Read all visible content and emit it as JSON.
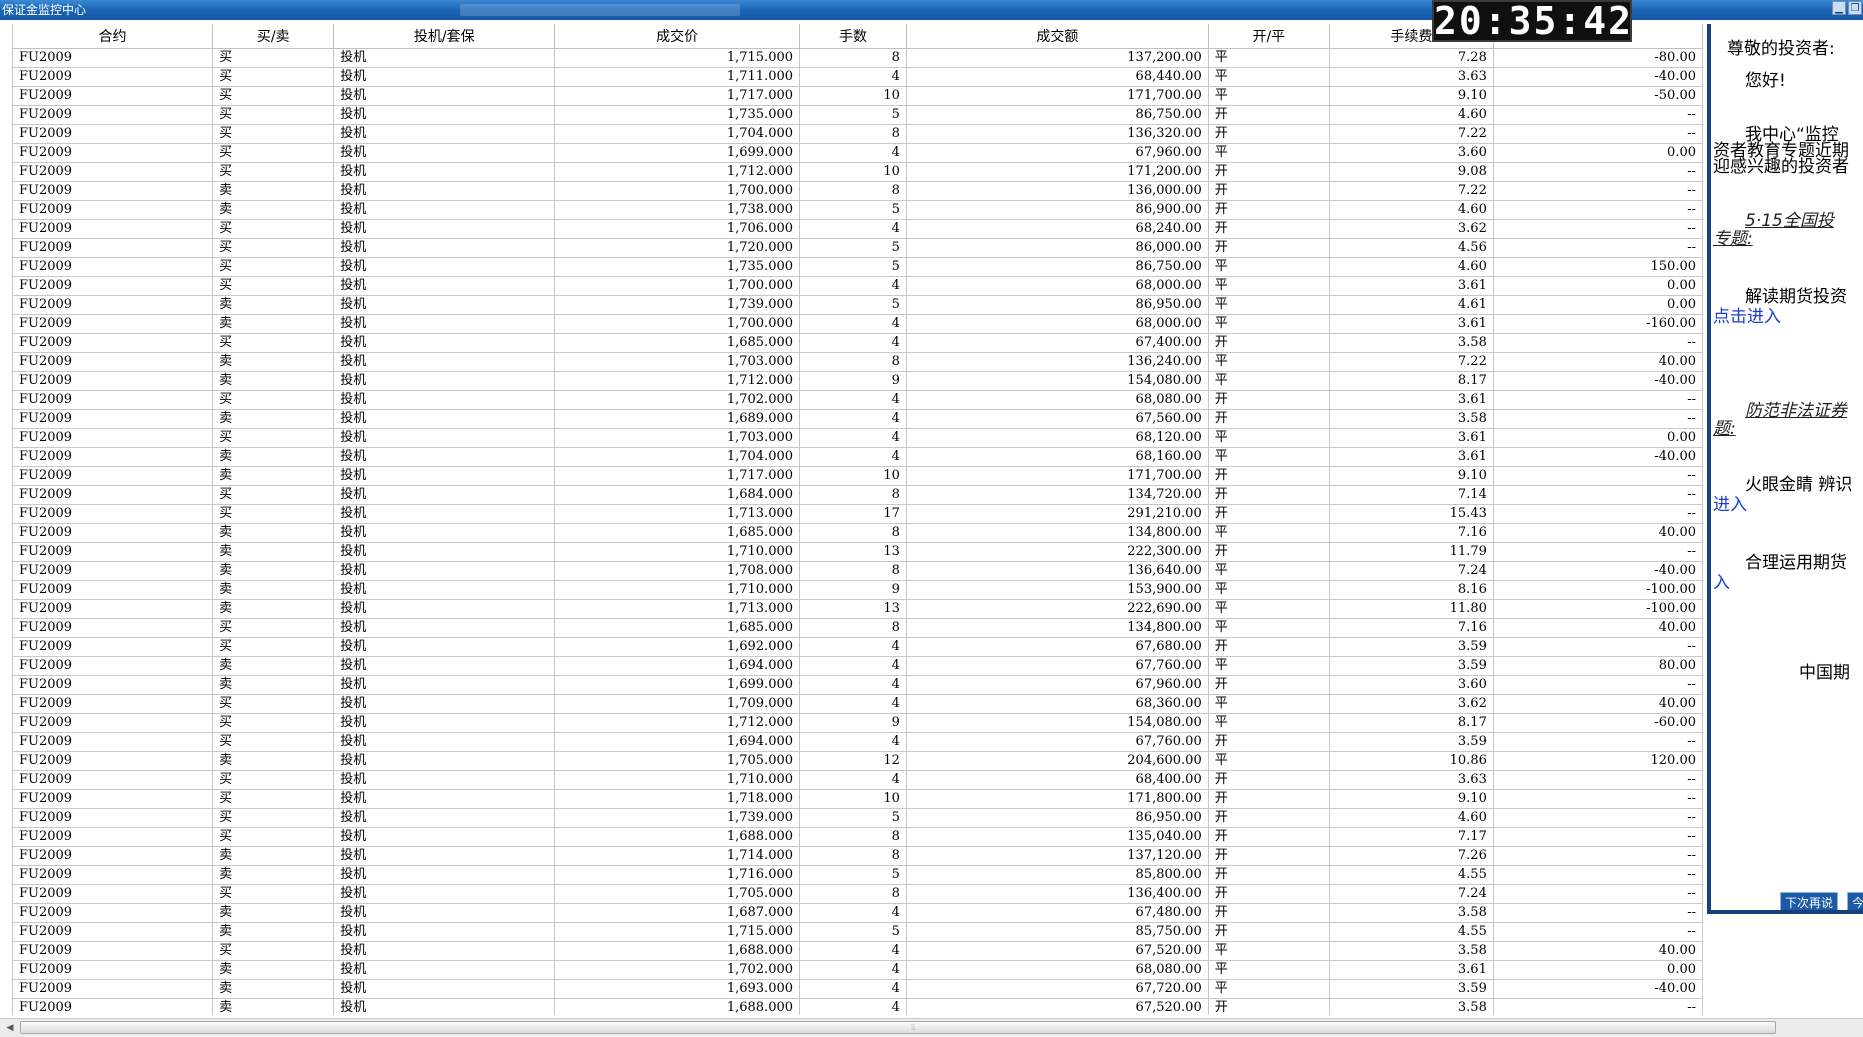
{
  "window": {
    "title": "保证金监控中心",
    "clock": "20:35:42"
  },
  "table": {
    "headers": [
      "合约",
      "买/卖",
      "投机/套保",
      "成交价",
      "手数",
      "成交额",
      "开/平",
      "手续费",
      ""
    ],
    "rows": [
      [
        "FU2009",
        "买",
        "投机",
        "1,715.000",
        "8",
        "137,200.00",
        "平",
        "7.28",
        "-80.00"
      ],
      [
        "FU2009",
        "买",
        "投机",
        "1,711.000",
        "4",
        "68,440.00",
        "平",
        "3.63",
        "-40.00"
      ],
      [
        "FU2009",
        "买",
        "投机",
        "1,717.000",
        "10",
        "171,700.00",
        "平",
        "9.10",
        "-50.00"
      ],
      [
        "FU2009",
        "买",
        "投机",
        "1,735.000",
        "5",
        "86,750.00",
        "开",
        "4.60",
        "--"
      ],
      [
        "FU2009",
        "买",
        "投机",
        "1,704.000",
        "8",
        "136,320.00",
        "开",
        "7.22",
        "--"
      ],
      [
        "FU2009",
        "买",
        "投机",
        "1,699.000",
        "4",
        "67,960.00",
        "平",
        "3.60",
        "0.00"
      ],
      [
        "FU2009",
        "买",
        "投机",
        "1,712.000",
        "10",
        "171,200.00",
        "开",
        "9.08",
        "--"
      ],
      [
        "FU2009",
        "卖",
        "投机",
        "1,700.000",
        "8",
        "136,000.00",
        "开",
        "7.22",
        "--"
      ],
      [
        "FU2009",
        "卖",
        "投机",
        "1,738.000",
        "5",
        "86,900.00",
        "开",
        "4.60",
        "--"
      ],
      [
        "FU2009",
        "买",
        "投机",
        "1,706.000",
        "4",
        "68,240.00",
        "开",
        "3.62",
        "--"
      ],
      [
        "FU2009",
        "买",
        "投机",
        "1,720.000",
        "5",
        "86,000.00",
        "开",
        "4.56",
        "--"
      ],
      [
        "FU2009",
        "买",
        "投机",
        "1,735.000",
        "5",
        "86,750.00",
        "平",
        "4.60",
        "150.00"
      ],
      [
        "FU2009",
        "买",
        "投机",
        "1,700.000",
        "4",
        "68,000.00",
        "平",
        "3.61",
        "0.00"
      ],
      [
        "FU2009",
        "卖",
        "投机",
        "1,739.000",
        "5",
        "86,950.00",
        "平",
        "4.61",
        "0.00"
      ],
      [
        "FU2009",
        "卖",
        "投机",
        "1,700.000",
        "4",
        "68,000.00",
        "平",
        "3.61",
        "-160.00"
      ],
      [
        "FU2009",
        "买",
        "投机",
        "1,685.000",
        "4",
        "67,400.00",
        "开",
        "3.58",
        "--"
      ],
      [
        "FU2009",
        "卖",
        "投机",
        "1,703.000",
        "8",
        "136,240.00",
        "平",
        "7.22",
        "40.00"
      ],
      [
        "FU2009",
        "卖",
        "投机",
        "1,712.000",
        "9",
        "154,080.00",
        "平",
        "8.17",
        "-40.00"
      ],
      [
        "FU2009",
        "买",
        "投机",
        "1,702.000",
        "4",
        "68,080.00",
        "开",
        "3.61",
        "--"
      ],
      [
        "FU2009",
        "卖",
        "投机",
        "1,689.000",
        "4",
        "67,560.00",
        "开",
        "3.58",
        "--"
      ],
      [
        "FU2009",
        "买",
        "投机",
        "1,703.000",
        "4",
        "68,120.00",
        "平",
        "3.61",
        "0.00"
      ],
      [
        "FU2009",
        "卖",
        "投机",
        "1,704.000",
        "4",
        "68,160.00",
        "平",
        "3.61",
        "-40.00"
      ],
      [
        "FU2009",
        "卖",
        "投机",
        "1,717.000",
        "10",
        "171,700.00",
        "开",
        "9.10",
        "--"
      ],
      [
        "FU2009",
        "买",
        "投机",
        "1,684.000",
        "8",
        "134,720.00",
        "开",
        "7.14",
        "--"
      ],
      [
        "FU2009",
        "买",
        "投机",
        "1,713.000",
        "17",
        "291,210.00",
        "开",
        "15.43",
        "--"
      ],
      [
        "FU2009",
        "卖",
        "投机",
        "1,685.000",
        "8",
        "134,800.00",
        "平",
        "7.16",
        "40.00"
      ],
      [
        "FU2009",
        "卖",
        "投机",
        "1,710.000",
        "13",
        "222,300.00",
        "开",
        "11.79",
        "--"
      ],
      [
        "FU2009",
        "卖",
        "投机",
        "1,708.000",
        "8",
        "136,640.00",
        "平",
        "7.24",
        "-40.00"
      ],
      [
        "FU2009",
        "卖",
        "投机",
        "1,710.000",
        "9",
        "153,900.00",
        "平",
        "8.16",
        "-100.00"
      ],
      [
        "FU2009",
        "卖",
        "投机",
        "1,713.000",
        "13",
        "222,690.00",
        "平",
        "11.80",
        "-100.00"
      ],
      [
        "FU2009",
        "买",
        "投机",
        "1,685.000",
        "8",
        "134,800.00",
        "平",
        "7.16",
        "40.00"
      ],
      [
        "FU2009",
        "买",
        "投机",
        "1,692.000",
        "4",
        "67,680.00",
        "开",
        "3.59",
        "--"
      ],
      [
        "FU2009",
        "卖",
        "投机",
        "1,694.000",
        "4",
        "67,760.00",
        "平",
        "3.59",
        "80.00"
      ],
      [
        "FU2009",
        "卖",
        "投机",
        "1,699.000",
        "4",
        "67,960.00",
        "开",
        "3.60",
        "--"
      ],
      [
        "FU2009",
        "买",
        "投机",
        "1,709.000",
        "4",
        "68,360.00",
        "平",
        "3.62",
        "40.00"
      ],
      [
        "FU2009",
        "买",
        "投机",
        "1,712.000",
        "9",
        "154,080.00",
        "平",
        "8.17",
        "-60.00"
      ],
      [
        "FU2009",
        "买",
        "投机",
        "1,694.000",
        "4",
        "67,760.00",
        "开",
        "3.59",
        "--"
      ],
      [
        "FU2009",
        "卖",
        "投机",
        "1,705.000",
        "12",
        "204,600.00",
        "平",
        "10.86",
        "120.00"
      ],
      [
        "FU2009",
        "买",
        "投机",
        "1,710.000",
        "4",
        "68,400.00",
        "开",
        "3.63",
        "--"
      ],
      [
        "FU2009",
        "买",
        "投机",
        "1,718.000",
        "10",
        "171,800.00",
        "开",
        "9.10",
        "--"
      ],
      [
        "FU2009",
        "买",
        "投机",
        "1,739.000",
        "5",
        "86,950.00",
        "开",
        "4.60",
        "--"
      ],
      [
        "FU2009",
        "买",
        "投机",
        "1,688.000",
        "8",
        "135,040.00",
        "开",
        "7.17",
        "--"
      ],
      [
        "FU2009",
        "卖",
        "投机",
        "1,714.000",
        "8",
        "137,120.00",
        "开",
        "7.26",
        "--"
      ],
      [
        "FU2009",
        "卖",
        "投机",
        "1,716.000",
        "5",
        "85,800.00",
        "开",
        "4.55",
        "--"
      ],
      [
        "FU2009",
        "买",
        "投机",
        "1,705.000",
        "8",
        "136,400.00",
        "开",
        "7.24",
        "--"
      ],
      [
        "FU2009",
        "卖",
        "投机",
        "1,687.000",
        "4",
        "67,480.00",
        "开",
        "3.58",
        "--"
      ],
      [
        "FU2009",
        "卖",
        "投机",
        "1,715.000",
        "5",
        "85,750.00",
        "开",
        "4.55",
        "--"
      ],
      [
        "FU2009",
        "买",
        "投机",
        "1,688.000",
        "4",
        "67,520.00",
        "平",
        "3.58",
        "40.00"
      ],
      [
        "FU2009",
        "卖",
        "投机",
        "1,702.000",
        "4",
        "68,080.00",
        "平",
        "3.61",
        "0.00"
      ],
      [
        "FU2009",
        "卖",
        "投机",
        "1,693.000",
        "4",
        "67,720.00",
        "平",
        "3.59",
        "-40.00"
      ],
      [
        "FU2009",
        "卖",
        "投机",
        "1,688.000",
        "4",
        "67,520.00",
        "开",
        "3.58",
        "--"
      ]
    ]
  },
  "notice": {
    "greeting": "尊敬的投资者:",
    "hello": "您好!",
    "para1_line1": "我中心“监控",
    "para1_line2": "资者教育专题近期",
    "para1_line3": "迎感兴趣的投资者",
    "topic1_line1": "5·15全国投",
    "topic1_line2": "专题:",
    "item1_text": "解读期货投资",
    "item1_link": "点击进入",
    "topic2_line1": "防范非法证券",
    "topic2_line2": "题:",
    "item2_text": "火眼金睛 辨识",
    "item2_link": "进入",
    "item3_text": "合理运用期货",
    "item3_link": "入",
    "signature": "中国期",
    "btn_later": "下次再说",
    "btn_today": "今"
  }
}
